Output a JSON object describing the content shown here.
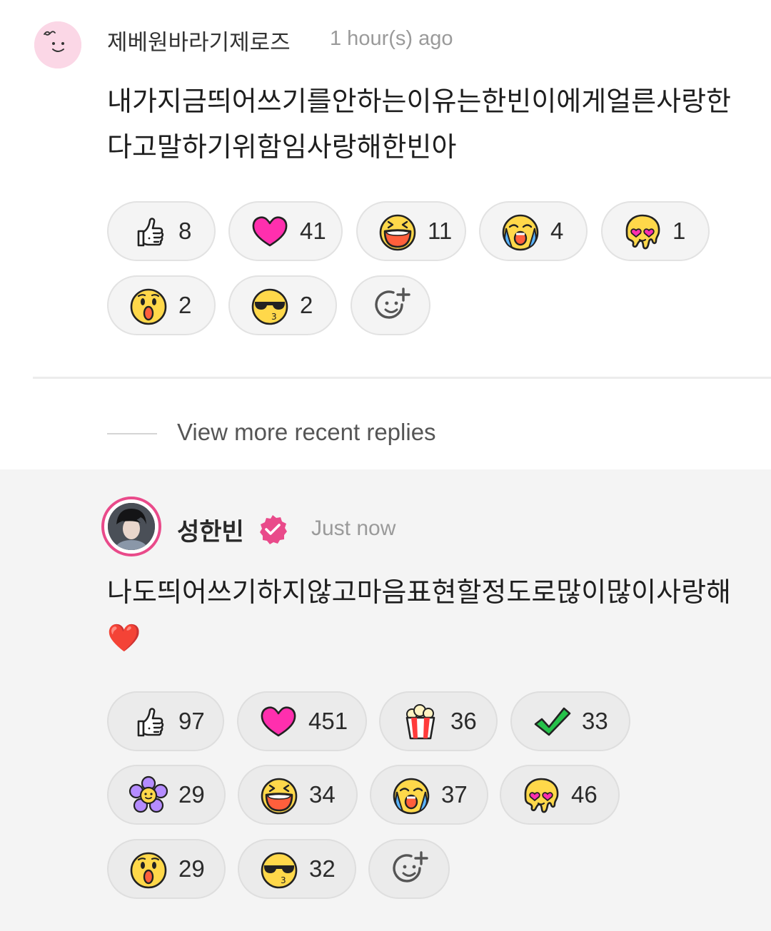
{
  "comment": {
    "author": "제베원바라기제로즈",
    "time": "1 hour(s) ago",
    "text": "내가지금띄어쓰기를안하는이유는한빈이에게얼른사랑한다고말하기위함임사랑해한빈아",
    "reactions": [
      {
        "icon": "thumbs-up-icon",
        "count": "8"
      },
      {
        "icon": "heart-icon",
        "count": "41"
      },
      {
        "icon": "laughing-face-icon",
        "count": "11"
      },
      {
        "icon": "crying-face-icon",
        "count": "4"
      },
      {
        "icon": "melting-heart-eyes-icon",
        "count": "1"
      },
      {
        "icon": "surprised-face-icon",
        "count": "2"
      },
      {
        "icon": "sunglasses-kiss-icon",
        "count": "2"
      }
    ]
  },
  "view_more": "View more recent replies",
  "reply": {
    "author": "성한빈",
    "time": "Just now",
    "text": "나도띄어쓰기하지않고마음표현할정도로많이많이사랑해❤️",
    "reactions": [
      {
        "icon": "thumbs-up-icon",
        "count": "97"
      },
      {
        "icon": "heart-icon",
        "count": "451"
      },
      {
        "icon": "popcorn-icon",
        "count": "36"
      },
      {
        "icon": "check-icon",
        "count": "33"
      },
      {
        "icon": "flower-icon",
        "count": "29"
      },
      {
        "icon": "laughing-face-icon",
        "count": "34"
      },
      {
        "icon": "crying-face-icon",
        "count": "37"
      },
      {
        "icon": "melting-heart-eyes-icon",
        "count": "46"
      },
      {
        "icon": "surprised-face-icon",
        "count": "29"
      },
      {
        "icon": "sunglasses-kiss-icon",
        "count": "32"
      }
    ]
  },
  "colors": {
    "accent": "#e94a8a",
    "heart": "#ff2fae",
    "emoji_yellow": "#ffd84a"
  }
}
